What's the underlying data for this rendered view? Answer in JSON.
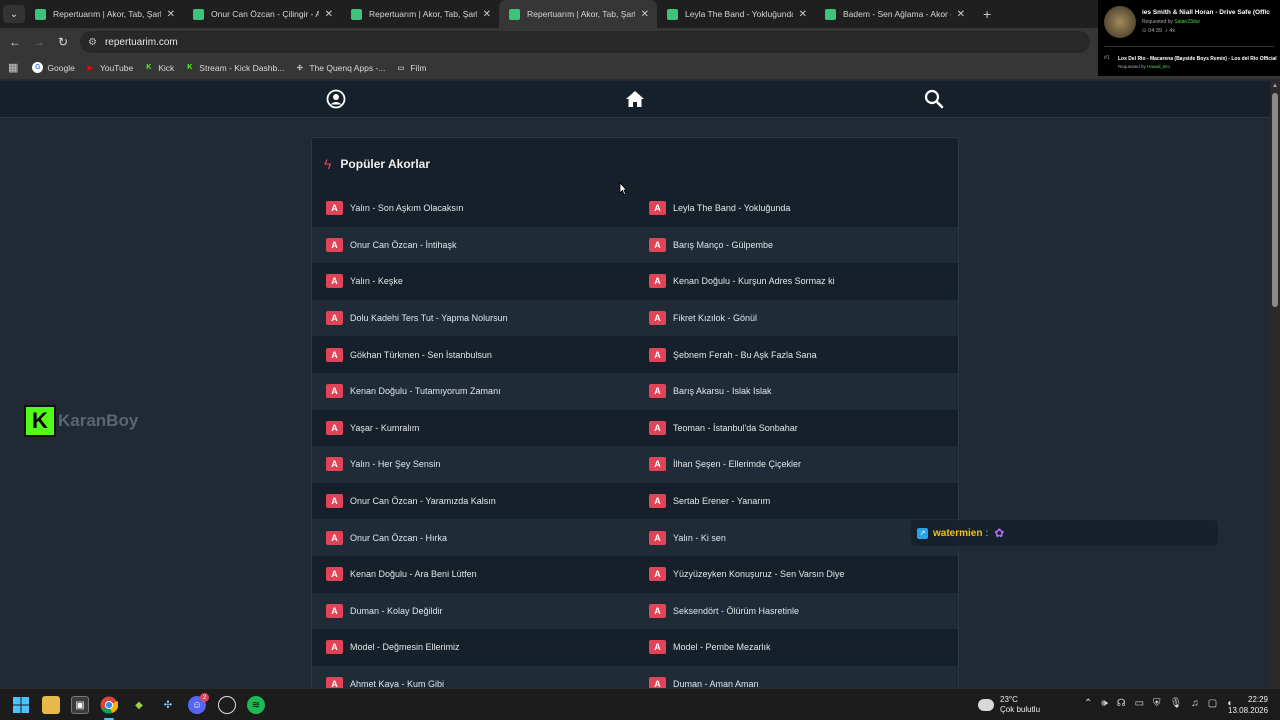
{
  "browser": {
    "tabs": [
      {
        "title": "Repertuarım | Akor, Tab, Şarkı Sö",
        "active": false
      },
      {
        "title": "Onur Can Özcan - Çilingir - Akor",
        "active": false
      },
      {
        "title": "Repertuarım | Akor, Tab, Şarkı Sö",
        "active": false
      },
      {
        "title": "Repertuarım | Akor, Tab, Şarkı Sö",
        "active": true
      },
      {
        "title": "Leyla The Band - Yokluğunda -",
        "active": false
      },
      {
        "title": "Badem - Sen Ağlama - Akor (Kı",
        "active": false
      }
    ],
    "new_tab": "+",
    "url": "repertuarim.com",
    "bookmarks": [
      {
        "label": "Google",
        "icon": "google-icon",
        "color": "#4285f4"
      },
      {
        "label": "YouTube",
        "icon": "youtube-icon",
        "color": "#ff0000"
      },
      {
        "label": "Kick",
        "icon": "kick-icon",
        "color": "#53fc18"
      },
      {
        "label": "Stream - Kick Dashb...",
        "icon": "kick-icon",
        "color": "#53fc18"
      },
      {
        "label": "The Quenq Apps -...",
        "icon": "puzzle-icon",
        "color": "#cccccc"
      },
      {
        "label": "Film",
        "icon": "folder-icon",
        "color": "#cccccc"
      }
    ]
  },
  "overlay": {
    "now_playing": {
      "title": "ies Smith & Niall Horan - Drive Safe (Offic",
      "requested_by_label": "Requested by",
      "requested_by": "Satan23dur",
      "time": "04:39",
      "count": "4x"
    },
    "queue": {
      "index": "#1",
      "title": "Los Del Rio - Macarena (Bayside Boys Remix) - Los del Rio Official",
      "requested_by_label": "Requested by",
      "requested_by": "Hawali_Bro"
    },
    "kick_channel": "KaranBoy",
    "chat": {
      "user": "watermien",
      "separator": ":"
    }
  },
  "site": {
    "section_title": "Popüler Akorlar",
    "badge": "A",
    "songs": [
      [
        "Yalın - Son Aşkım Olacaksın",
        "Leyla The Band - Yokluğunda"
      ],
      [
        "Onur Can Özcan - İntihaşk",
        "Barış Manço - Gülpembe"
      ],
      [
        "Yalın - Keşke",
        "Kenan Doğulu - Kurşun Adres Sormaz ki"
      ],
      [
        "Dolu Kadehi Ters Tut - Yapma Nolursun",
        "Fikret Kızılok - Gönül"
      ],
      [
        "Gökhan Türkmen - Sen İstanbulsun",
        "Şebnem Ferah - Bu Aşk Fazla Sana"
      ],
      [
        "Kenan Doğulu - Tutamıyorum Zamanı",
        "Barış Akarsu - Islak Islak"
      ],
      [
        "Yaşar - Kumralım",
        "Teoman - İstanbul'da Sonbahar"
      ],
      [
        "Yalın - Her Şey Sensin",
        "İlhan Şeşen - Ellerimde Çiçekler"
      ],
      [
        "Onur Can Özcan - Yaramızda Kalsın",
        "Sertab Erener - Yanarım"
      ],
      [
        "Onur Can Özcan - Hırka",
        "Yalın - Ki sen"
      ],
      [
        "Kenan Doğulu - Ara Beni Lütfen",
        "Yüzyüzeyken Konuşuruz - Sen Varsın Diye"
      ],
      [
        "Duman - Kolay Değildir",
        "Seksendört - Ölürüm Hasretinle"
      ],
      [
        "Model - Değmesin Ellerimiz",
        "Model - Pembe Mezarlık"
      ],
      [
        "Ahmet Kaya - Kum Gibi",
        "Duman - Aman Aman"
      ]
    ],
    "accent": "#e04456"
  },
  "taskbar": {
    "temperature": "23°C",
    "weather": "Çok bulutlu",
    "time": "22:29",
    "date": "13.08.2026",
    "discord_badge": "2"
  }
}
